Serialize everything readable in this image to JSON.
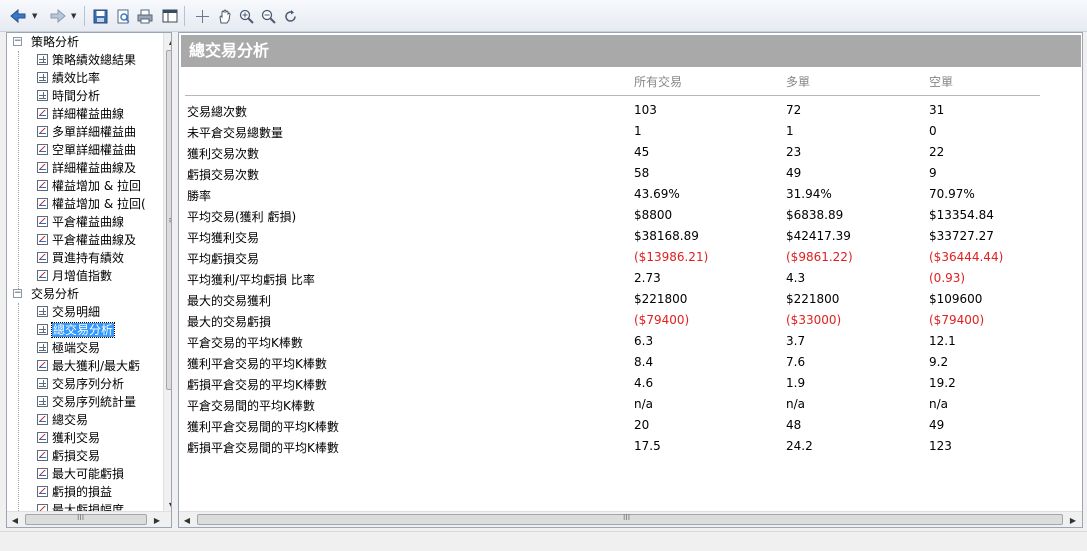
{
  "toolbar": {
    "icons": [
      "back-arrow-icon",
      "forward-arrow-icon",
      "save-icon",
      "print-preview-icon",
      "print-icon",
      "window-icon",
      "crosshair-icon",
      "hand-icon",
      "zoom-in-icon",
      "zoom-out-icon",
      "refresh-icon"
    ]
  },
  "tree": {
    "groups": [
      {
        "label": "策略分析",
        "items": [
          {
            "label": "策略績效總結果",
            "icon": "table"
          },
          {
            "label": "績效比率",
            "icon": "table"
          },
          {
            "label": "時間分析",
            "icon": "table"
          },
          {
            "label": "詳細權益曲線",
            "icon": "chart"
          },
          {
            "label": "多單詳細權益曲",
            "icon": "chart"
          },
          {
            "label": "空單詳細權益曲",
            "icon": "chart"
          },
          {
            "label": "詳細權益曲線及",
            "icon": "chart"
          },
          {
            "label": "權益增加 & 拉回",
            "icon": "chart"
          },
          {
            "label": "權益增加 & 拉回(",
            "icon": "chart"
          },
          {
            "label": "平倉權益曲線",
            "icon": "chart"
          },
          {
            "label": "平倉權益曲線及",
            "icon": "chart"
          },
          {
            "label": "買進持有績效",
            "icon": "chart"
          },
          {
            "label": "月增值指數",
            "icon": "chart"
          }
        ]
      },
      {
        "label": "交易分析",
        "items": [
          {
            "label": "交易明細",
            "icon": "table"
          },
          {
            "label": "總交易分析",
            "icon": "table",
            "selected": true
          },
          {
            "label": "極端交易",
            "icon": "table"
          },
          {
            "label": "最大獲利/最大虧",
            "icon": "chart"
          },
          {
            "label": "交易序列分析",
            "icon": "table"
          },
          {
            "label": "交易序列統計量",
            "icon": "table"
          },
          {
            "label": "總交易",
            "icon": "chart"
          },
          {
            "label": "獲利交易",
            "icon": "chart"
          },
          {
            "label": "虧損交易",
            "icon": "chart"
          },
          {
            "label": "最大可能虧損",
            "icon": "chart"
          },
          {
            "label": "虧損的損益",
            "icon": "chart"
          },
          {
            "label": "最大虧損幅度",
            "icon": "chart"
          }
        ]
      }
    ]
  },
  "report": {
    "title": "總交易分析",
    "columns": [
      "所有交易",
      "多單",
      "空單"
    ],
    "rows": [
      {
        "label": "交易總次數",
        "values": [
          "103",
          "72",
          "31"
        ]
      },
      {
        "label": "未平倉交易總數量",
        "values": [
          "1",
          "1",
          "0"
        ]
      },
      {
        "label": "獲利交易次數",
        "values": [
          "45",
          "23",
          "22"
        ]
      },
      {
        "label": "虧損交易次數",
        "values": [
          "58",
          "49",
          "9"
        ]
      },
      {
        "label": "勝率",
        "values": [
          "43.69%",
          "31.94%",
          "70.97%"
        ]
      },
      {
        "label": "平均交易(獲利 虧損)",
        "values": [
          "$8800",
          "$6838.89",
          "$13354.84"
        ]
      },
      {
        "label": "平均獲利交易",
        "values": [
          "$38168.89",
          "$42417.39",
          "$33727.27"
        ]
      },
      {
        "label": "平均虧損交易",
        "values": [
          "($13986.21)",
          "($9861.22)",
          "($36444.44)"
        ],
        "negative": [
          true,
          true,
          true
        ]
      },
      {
        "label": "平均獲利/平均虧損 比率",
        "values": [
          "2.73",
          "4.3",
          "(0.93)"
        ],
        "negative": [
          false,
          false,
          true
        ]
      },
      {
        "label": "最大的交易獲利",
        "values": [
          "$221800",
          "$221800",
          "$109600"
        ]
      },
      {
        "label": "最大的交易虧損",
        "values": [
          "($79400)",
          "($33000)",
          "($79400)"
        ],
        "negative": [
          true,
          true,
          true
        ]
      },
      {
        "label": "平倉交易的平均K棒數",
        "values": [
          "6.3",
          "3.7",
          "12.1"
        ]
      },
      {
        "label": "獲利平倉交易的平均K棒數",
        "values": [
          "8.4",
          "7.6",
          "9.2"
        ]
      },
      {
        "label": "虧損平倉交易的平均K棒數",
        "values": [
          "4.6",
          "1.9",
          "19.2"
        ]
      },
      {
        "label": "平倉交易間的平均K棒數",
        "values": [
          "n/a",
          "n/a",
          "n/a"
        ]
      },
      {
        "label": "獲利平倉交易間的平均K棒數",
        "values": [
          "20",
          "48",
          "49"
        ]
      },
      {
        "label": "虧損平倉交易間的平均K棒數",
        "values": [
          "17.5",
          "24.2",
          "123"
        ]
      }
    ]
  },
  "scroll": {
    "thumb_grip": "III"
  }
}
